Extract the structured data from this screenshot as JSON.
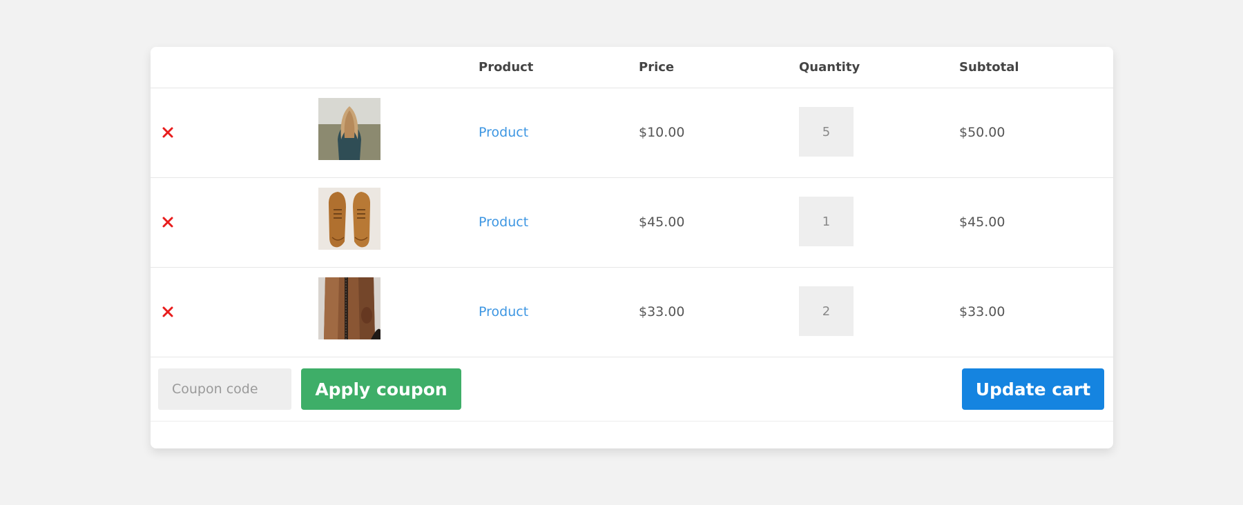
{
  "header": {
    "product": "Product",
    "price": "Price",
    "quantity": "Quantity",
    "subtotal": "Subtotal"
  },
  "items": [
    {
      "remove_icon": "close-icon",
      "image": "woman-photo",
      "name": "Product",
      "price": "$10.00",
      "quantity": "5",
      "subtotal": "$50.00"
    },
    {
      "remove_icon": "close-icon",
      "image": "shoes-photo",
      "name": "Product",
      "price": "$45.00",
      "quantity": "1",
      "subtotal": "$45.00"
    },
    {
      "remove_icon": "close-icon",
      "image": "leather-bag-photo",
      "name": "Product",
      "price": "$33.00",
      "quantity": "2",
      "subtotal": "$33.00"
    }
  ],
  "actions": {
    "coupon_placeholder": "Coupon code",
    "apply_coupon_label": "Apply coupon",
    "update_cart_label": "Update cart"
  },
  "colors": {
    "remove": "#e81c1c",
    "link": "#3d96e2",
    "apply_button": "#3eae68",
    "update_button": "#1584e0"
  }
}
